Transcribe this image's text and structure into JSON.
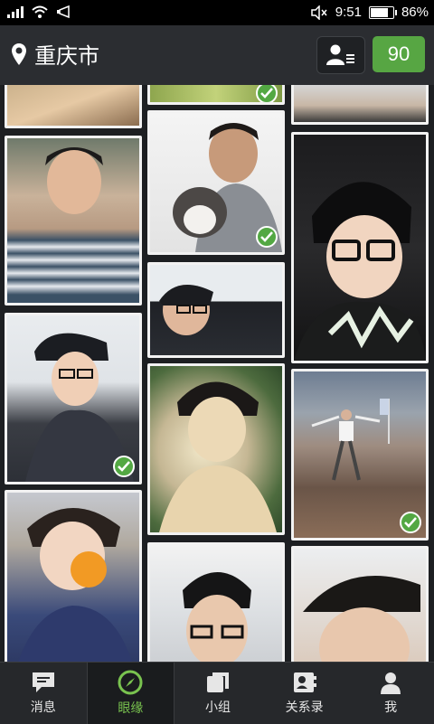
{
  "status_bar": {
    "time": "9:51",
    "battery": "86%",
    "battery_level": 0.86
  },
  "header": {
    "location": "重庆市",
    "count": "90"
  },
  "tabs": [
    {
      "label": "消息",
      "icon": "message-icon",
      "active": false
    },
    {
      "label": "眼缘",
      "icon": "compass-icon",
      "active": true
    },
    {
      "label": "小组",
      "icon": "group-icon",
      "active": false
    },
    {
      "label": "关系录",
      "icon": "contacts-icon",
      "active": false
    },
    {
      "label": "我",
      "icon": "person-icon",
      "active": false
    }
  ],
  "photos": [
    {
      "verified": false
    },
    {
      "verified": false
    },
    {
      "verified": false
    },
    {
      "verified": false
    },
    {
      "verified": true
    },
    {
      "verified": false
    },
    {
      "verified": false
    },
    {
      "verified": true
    },
    {
      "verified": false
    },
    {
      "verified": false
    },
    {
      "verified": true
    },
    {
      "verified": false
    },
    {
      "verified": false
    },
    {
      "verified": false
    }
  ]
}
